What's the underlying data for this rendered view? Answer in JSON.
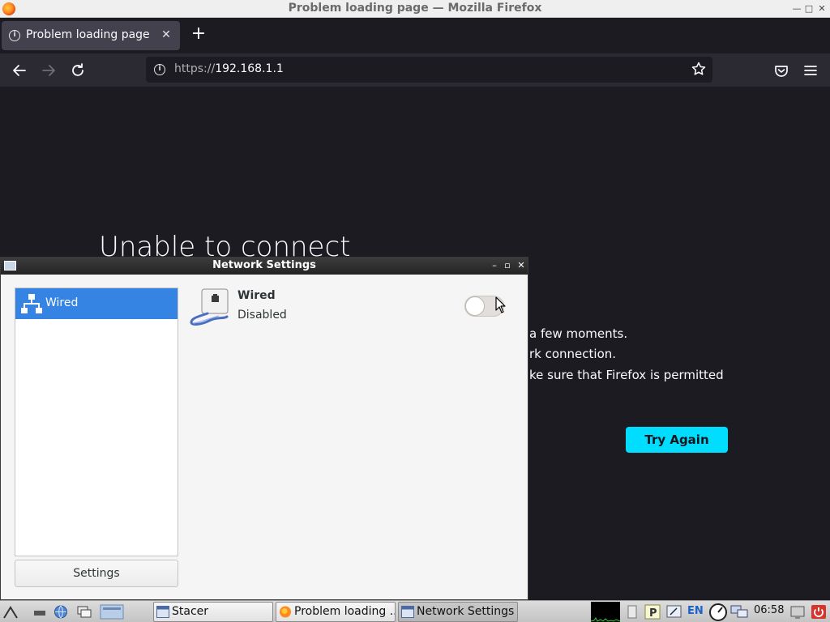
{
  "firefox": {
    "window_title": "Problem loading page — Mozilla Firefox",
    "tab_title": "Problem loading page",
    "url_scheme": "https://",
    "url_host": "192.168.1.1",
    "error_heading": "Unable to connect",
    "error_lines": [
      "a few moments.",
      "rk connection.",
      "ke sure that Firefox is permitted"
    ],
    "try_again_label": "Try Again",
    "accent_color": "#00ddff"
  },
  "network_settings": {
    "title": "Network Settings",
    "list": [
      {
        "label": "Wired",
        "selected": true
      }
    ],
    "settings_button": "Settings",
    "device": {
      "name": "Wired",
      "status": "Disabled",
      "enabled": false
    },
    "selection_color": "#3584e4"
  },
  "taskbar": {
    "tasks": [
      {
        "label": "Stacer",
        "active": false
      },
      {
        "label": "Problem loading ...",
        "active": false
      },
      {
        "label": "Network Settings",
        "active": true
      }
    ],
    "language": "EN",
    "clock": "06:58"
  }
}
